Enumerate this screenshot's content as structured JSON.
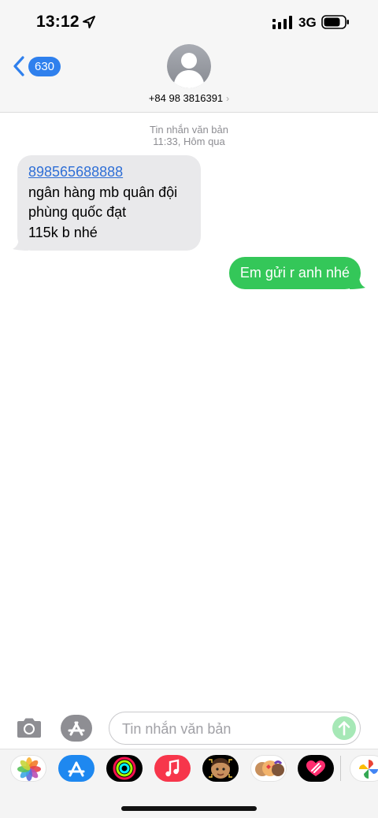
{
  "status_bar": {
    "time": "13:12",
    "network": "3G",
    "icons": [
      "location-arrow-icon",
      "signal-bars-icon",
      "battery-icon"
    ]
  },
  "header": {
    "back_count": "630",
    "contact_number": "+84 98 3816391",
    "contact_chevron": "›"
  },
  "conversation": {
    "meta_label": "Tin nhắn văn bản",
    "meta_time": "11:33, Hôm qua",
    "incoming": {
      "link": "898565688888",
      "lines": [
        "ngân hàng mb quân đội",
        "phùng quốc đạt",
        "115k b nhé"
      ]
    },
    "outgoing": "Em gửi r anh nhé"
  },
  "compose": {
    "placeholder": "Tin nhắn văn bản"
  },
  "drawer_apps": [
    "photos-app-icon",
    "app-store-app-icon",
    "activity-app-icon",
    "music-app-icon",
    "memoji-app-icon",
    "animoji-app-icon",
    "digital-touch-app-icon",
    "google-photos-app-icon"
  ],
  "colors": {
    "header_bg": "#f6f6f6",
    "incoming_bubble": "#e9e9eb",
    "outgoing_bubble": "#34c759",
    "accent_blue": "#2f80ed",
    "meta_text": "#8e8e93"
  }
}
